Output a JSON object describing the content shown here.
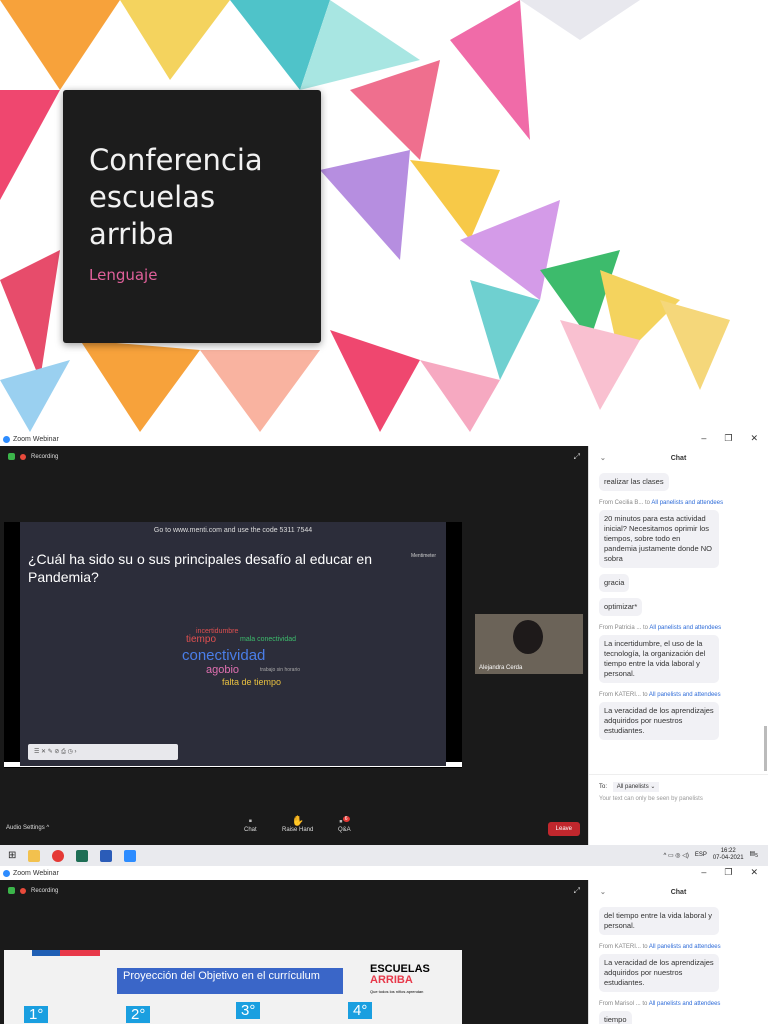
{
  "slide": {
    "title": "Conferencia escuelas arriba",
    "subtitle": "Lenguaje"
  },
  "window1": {
    "app_title": "Zoom Webinar",
    "window_controls": [
      "–",
      "❐",
      "✕"
    ],
    "recording": "Recording",
    "menti": {
      "code_text": "Go to www.menti.com and use the code 5311 7544",
      "question": "¿Cuál ha sido su o sus principales desafío al educar en Pandemia?",
      "brand": "Mentimeter",
      "words": [
        "conectividad",
        "agobio",
        "falta de tiempo",
        "tiempo",
        "mala conectividad",
        "incertidumbre",
        "trabajo sin horario"
      ]
    },
    "participant": "Alejandra Cerda",
    "controls": {
      "audio": "Audio Settings",
      "chat": "Chat",
      "raise_hand": "Raise Hand",
      "qa": "Q&A",
      "qa_badge": "6",
      "leave": "Leave"
    },
    "chat": {
      "title": "Chat",
      "messages": [
        {
          "text": "realizar las clases"
        },
        {
          "from": "From Cecilia B...",
          "to": "All panelists and attendees",
          "texts": [
            "20 minutos para esta actividad inicial? Necesitamos oprimir los tiempos, sobre todo en pandemia justamente donde NO sobra",
            "gracia",
            "optimizar*"
          ]
        },
        {
          "from": "From Patricia ...",
          "to": "All panelists and attendees",
          "texts": [
            "La incertidumbre, el uso de la tecnología, la organización del tiempo entre la vida laboral y personal."
          ]
        },
        {
          "from": "From KATERI...",
          "to": "All panelists and attendees",
          "texts": [
            "La veracidad de los aprendizajes adquiridos por nuestros estudiantes."
          ]
        }
      ],
      "to_label": "To:",
      "to_value": "All panelists",
      "note": "Your text can only be seen by panelists"
    }
  },
  "taskbar": {
    "lang": "ESP",
    "time": "16:22",
    "date": "07-04-2021",
    "notif": "5"
  },
  "window2": {
    "app_title": "Zoom Webinar",
    "recording": "Recording",
    "slide_title": "Proyección del Objetivo en el currículum",
    "logo_line1": "ESCUELAS",
    "logo_line2": "ARRIBA",
    "logo_tag": "Que todos los niños aprendan",
    "grades": [
      "1°",
      "2°",
      "3°",
      "4°"
    ],
    "chat": {
      "title": "Chat",
      "msg1": "del tiempo entre la vida laboral y personal.",
      "from2": "From KATERI...",
      "to2": "All panelists and attendees",
      "msg2": "La veracidad de los aprendizajes adquiridos por nuestros estudiantes.",
      "from3": "From Marisol ...",
      "to3": "All panelists and attendees",
      "msg3": "tiempo"
    }
  }
}
